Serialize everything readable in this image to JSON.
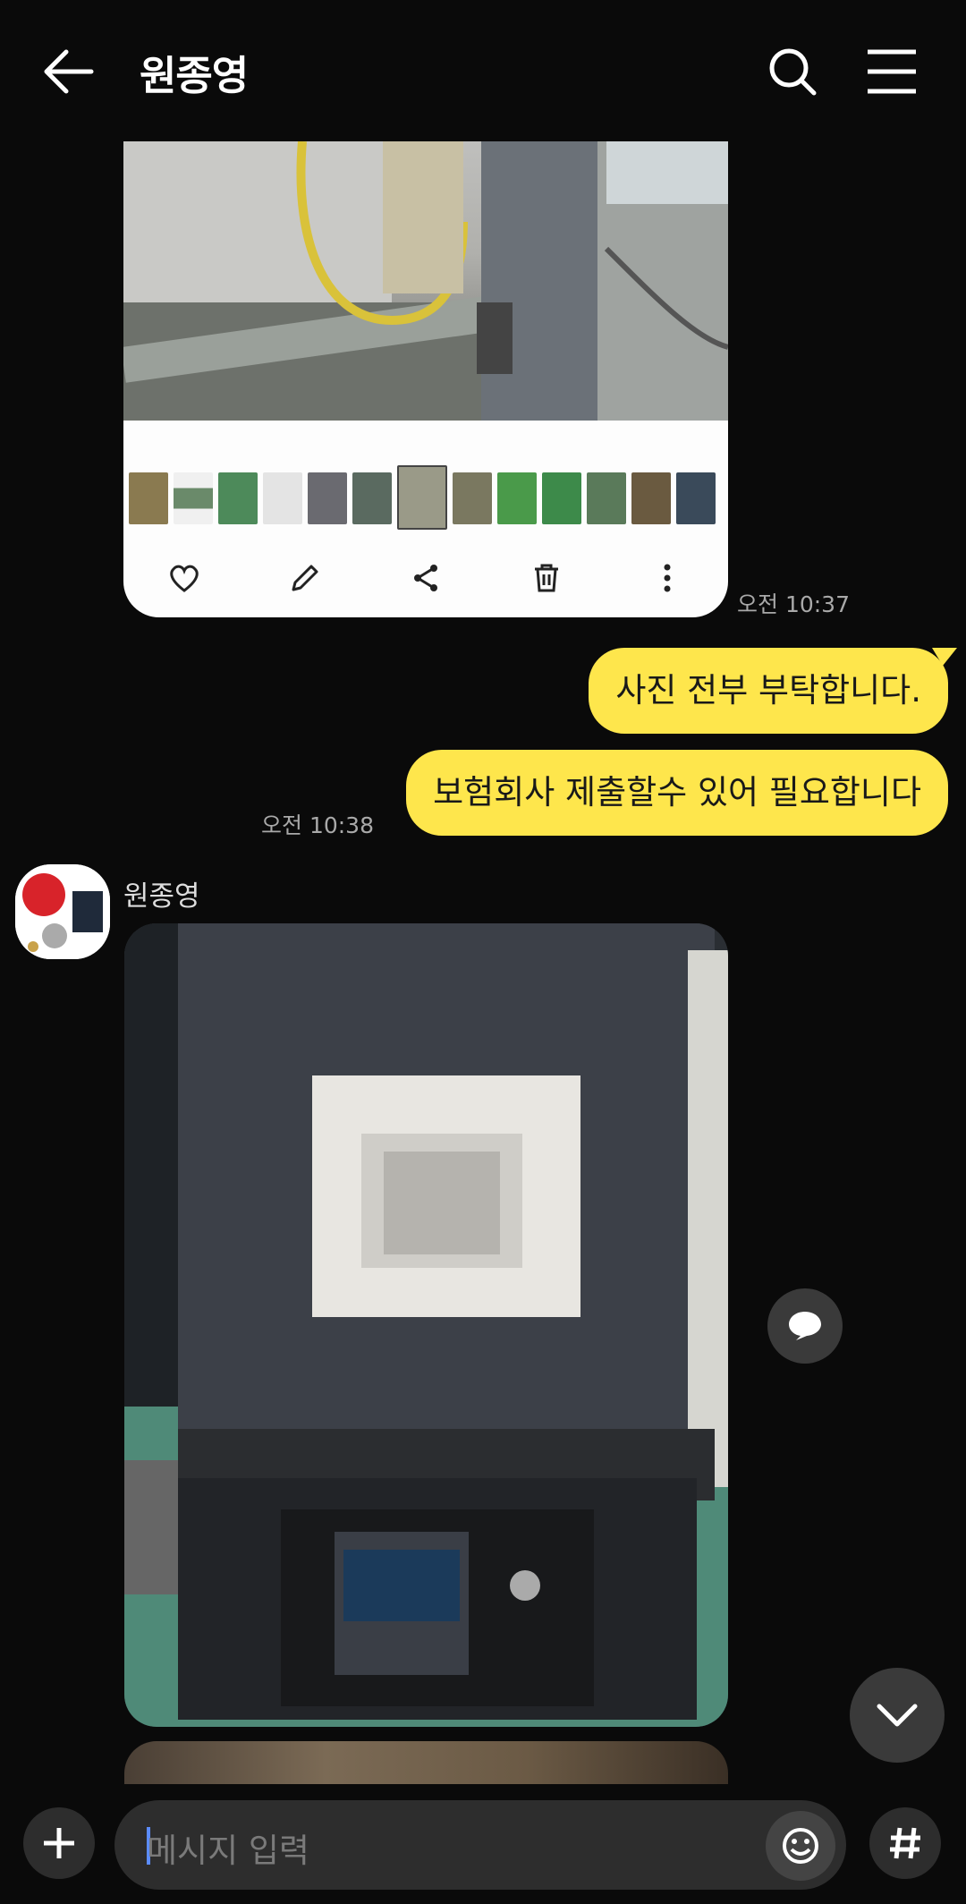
{
  "header": {
    "title": "원종영"
  },
  "messages": {
    "viewer_time": "오전 10:37",
    "me_1": "사진 전부 부탁합니다.",
    "me_2": "보험회사 제출할수 있어 필요합니다",
    "me_2_time": "오전 10:38",
    "sender_name": "원종영"
  },
  "input": {
    "placeholder": "메시지 입력"
  },
  "colors": {
    "background": "#0a0a0a",
    "my_bubble": "#fee64c",
    "surface": "#2d2d2d"
  },
  "icons": [
    "back-arrow-icon",
    "search-icon",
    "hamburger-menu-icon",
    "heart-icon",
    "pencil-icon",
    "share-icon",
    "trash-icon",
    "more-vertical-icon",
    "speech-bubble-icon",
    "chevron-down-icon",
    "plus-icon",
    "emoji-icon",
    "hash-icon"
  ]
}
